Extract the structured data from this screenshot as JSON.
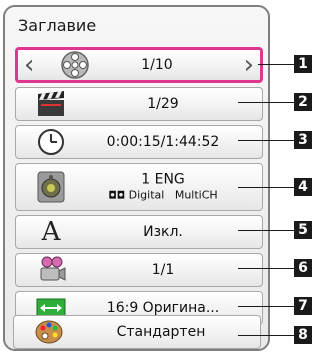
{
  "panel": {
    "title": "Заглавие"
  },
  "rows": [
    {
      "number": "1",
      "icon": "film-reel-icon",
      "value": "1/10"
    },
    {
      "number": "2",
      "icon": "clapperboard-icon",
      "value": "1/29"
    },
    {
      "number": "3",
      "icon": "clock-icon",
      "value": "0:00:15/1:44:52"
    },
    {
      "number": "4",
      "icon": "speaker-icon",
      "value": "1 ENG",
      "detail_left": "Digital",
      "detail_right": "MultiCH"
    },
    {
      "number": "5",
      "icon": "subtitle-letter-icon",
      "icon_glyph": "A",
      "value": "Изкл."
    },
    {
      "number": "6",
      "icon": "camera-angle-icon",
      "value": "1/1"
    },
    {
      "number": "7",
      "icon": "aspect-ratio-icon",
      "value": "16:9 Оригина..."
    },
    {
      "number": "8",
      "icon": "palette-icon",
      "value": "Стандартен"
    }
  ],
  "colors": {
    "selected_border": "#e0378e",
    "badge": "#1a1a1a"
  }
}
